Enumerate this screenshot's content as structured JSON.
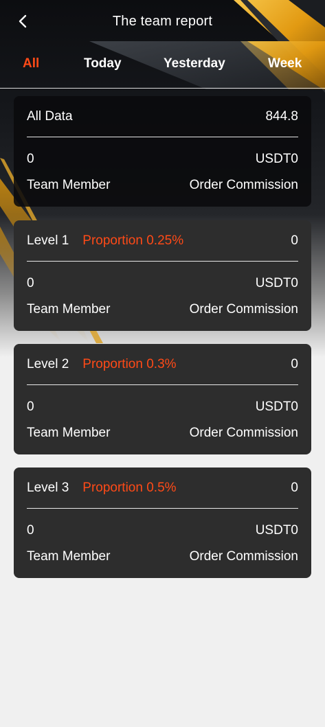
{
  "header": {
    "title": "The team report"
  },
  "tabs": [
    {
      "label": "All",
      "active": true
    },
    {
      "label": "Today",
      "active": false
    },
    {
      "label": "Yesterday",
      "active": false
    },
    {
      "label": "Week",
      "active": false
    }
  ],
  "summary": {
    "label": "All Data",
    "total": "844.8",
    "team_member_value": "0",
    "commission_value": "USDT0",
    "team_member_label": "Team Member",
    "commission_label": "Order Commission"
  },
  "levels": [
    {
      "label": "Level 1",
      "proportion": "Proportion 0.25%",
      "total": "0",
      "team_member_value": "0",
      "commission_value": "USDT0",
      "team_member_label": "Team Member",
      "commission_label": "Order Commission"
    },
    {
      "label": "Level 2",
      "proportion": "Proportion 0.3%",
      "total": "0",
      "team_member_value": "0",
      "commission_value": "USDT0",
      "team_member_label": "Team Member",
      "commission_label": "Order Commission"
    },
    {
      "label": "Level 3",
      "proportion": "Proportion 0.5%",
      "total": "0",
      "team_member_value": "0",
      "commission_value": "USDT0",
      "team_member_label": "Team Member",
      "commission_label": "Order Commission"
    }
  ],
  "colors": {
    "accent": "#ff4a17",
    "card_dark": "#0a0a0c",
    "card_gray": "#2d2d2d",
    "page_bg": "#f0f0f0",
    "gold": "#e6a21a"
  },
  "icons": {
    "back": "chevron-left-icon"
  }
}
